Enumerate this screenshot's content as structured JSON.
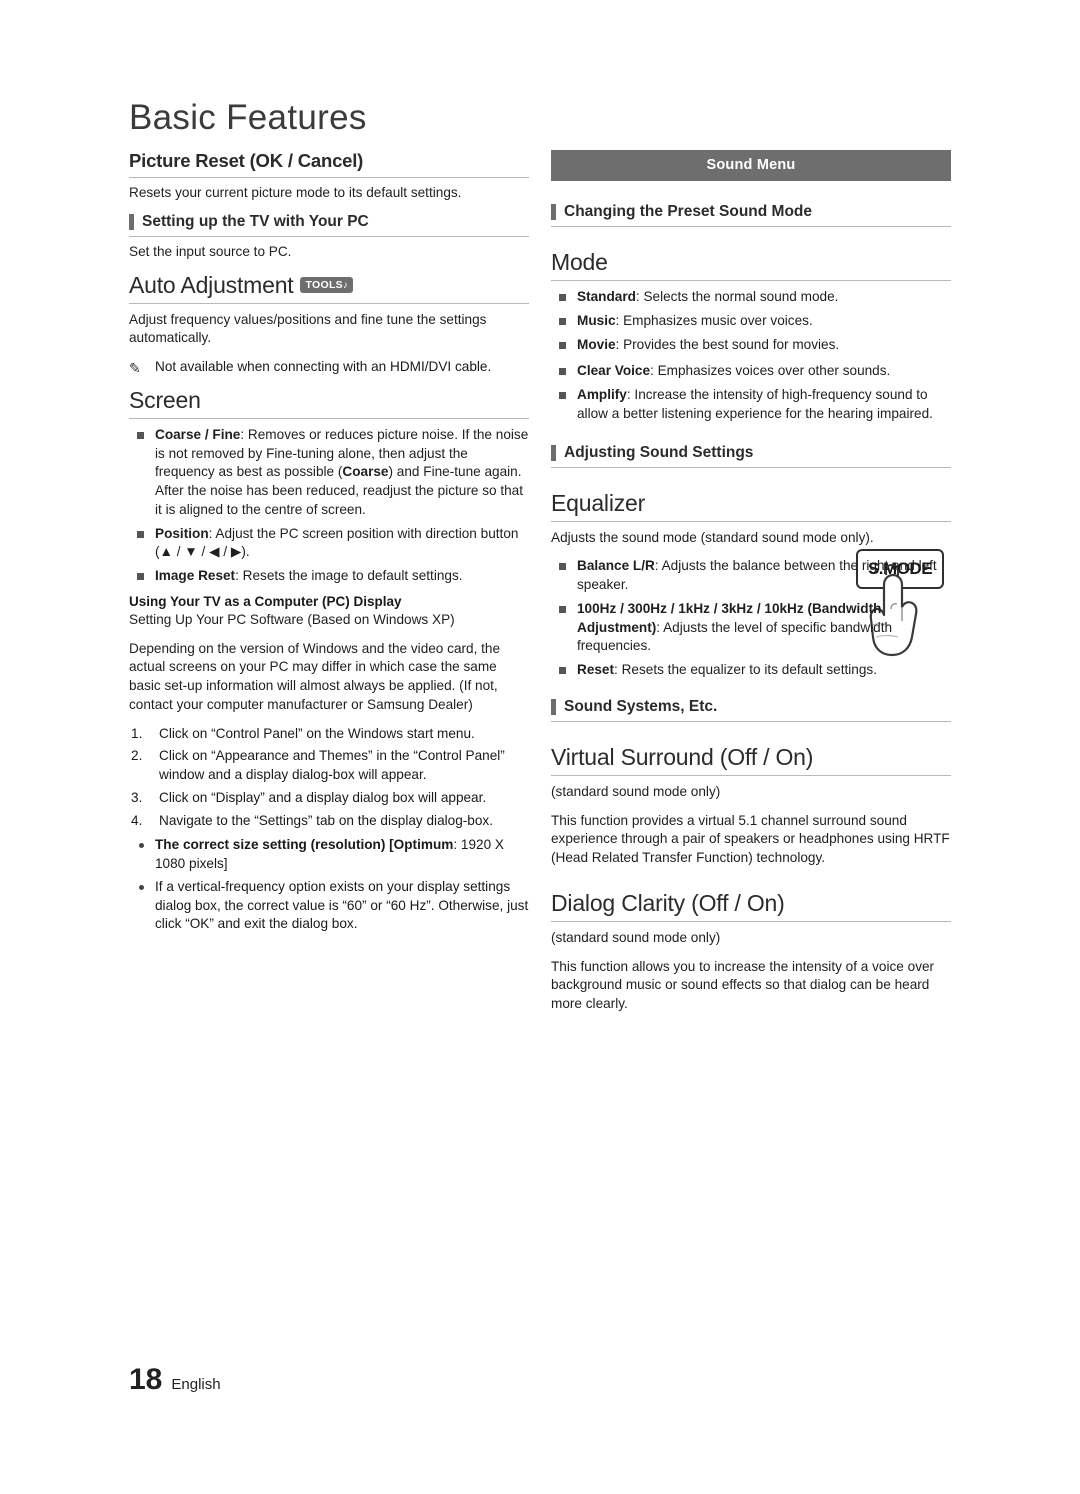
{
  "page": {
    "title": "Basic Features",
    "number": "18",
    "language": "English"
  },
  "left": {
    "picture_reset": {
      "heading": "Picture Reset (OK / Cancel)",
      "body": "Resets your current picture mode to its default settings."
    },
    "setting_up_pc": {
      "heading": "Setting up the TV with Your PC",
      "body": "Set the input source to PC."
    },
    "auto_adjustment": {
      "heading": "Auto Adjustment",
      "badge": "TOOLS",
      "body": "Adjust frequency values/positions and fine tune the settings automatically.",
      "note": "Not available when connecting with an HDMI/DVI cable."
    },
    "screen": {
      "heading": "Screen",
      "items": [
        "Coarse / Fine: Removes or reduces picture noise. If the noise is not removed by Fine-tuning alone, then adjust the frequency as best as possible (Coarse) and Fine-tune again. After the noise has been reduced, readjust the picture so that it is aligned to the centre of screen.",
        "Position: Adjust the PC screen position with direction button (▲ / ▼ / ◀ / ▶).",
        "Image Reset: Resets the image to default settings."
      ]
    },
    "pc_display": {
      "heading": "Using Your TV as a Computer (PC) Display",
      "sub": "Setting Up Your PC Software (Based on Windows XP)",
      "body": "Depending on the version of Windows and the video card, the actual screens on your PC may differ in which case the same basic set-up information will almost always be applied. (If not, contact your computer manufacturer or Samsung Dealer)",
      "steps": [
        "Click on “Control Panel” on the Windows start menu.",
        "Click on “Appearance and Themes” in the “Control Panel” window and a display dialog-box will appear.",
        "Click on “Display” and a display dialog box will appear.",
        "Navigate to the “Settings” tab on the display dialog-box."
      ],
      "dots": [
        "The correct size setting (resolution) [Optimum: 1920 X 1080 pixels]",
        "If a vertical-frequency option exists on your display settings dialog box, the correct value is “60” or “60 Hz”. Otherwise, just click “OK” and exit the dialog box."
      ]
    }
  },
  "right": {
    "banner": "Sound Menu",
    "preset_sound": {
      "heading": "Changing the Preset Sound Mode",
      "mode_heading": "Mode",
      "key_label": "S.MODE",
      "items": [
        "Standard: Selects the normal sound mode.",
        "Music: Emphasizes music over voices.",
        "Movie: Provides the best sound for movies.",
        "Clear Voice: Emphasizes voices over other sounds.",
        "Amplify: Increase the intensity of high-frequency sound to allow a better listening experience for the hearing impaired."
      ]
    },
    "adjusting_sound": {
      "heading": "Adjusting Sound Settings",
      "equalizer_heading": "Equalizer",
      "body": "Adjusts the sound mode (standard sound mode only).",
      "items": [
        "Balance L/R: Adjusts the balance between the right and left speaker.",
        "100Hz / 300Hz / 1kHz / 3kHz / 10kHz (Bandwidth Adjustment): Adjusts the level of specific bandwidth frequencies.",
        "Reset: Resets the equalizer to its default settings."
      ]
    },
    "sound_systems": {
      "heading": "Sound Systems, Etc.",
      "virtual_surround": {
        "heading": "Virtual Surround (Off / On)",
        "note": "(standard sound mode only)",
        "body": "This function provides a virtual 5.1 channel surround sound experience through a pair of speakers or headphones using HRTF (Head Related Transfer Function) technology."
      },
      "dialog_clarity": {
        "heading": "Dialog Clarity (Off / On)",
        "note": "(standard sound mode only)",
        "body": "This function allows you to increase the intensity of a voice over background music or sound effects so that dialog can be heard more clearly."
      }
    }
  }
}
